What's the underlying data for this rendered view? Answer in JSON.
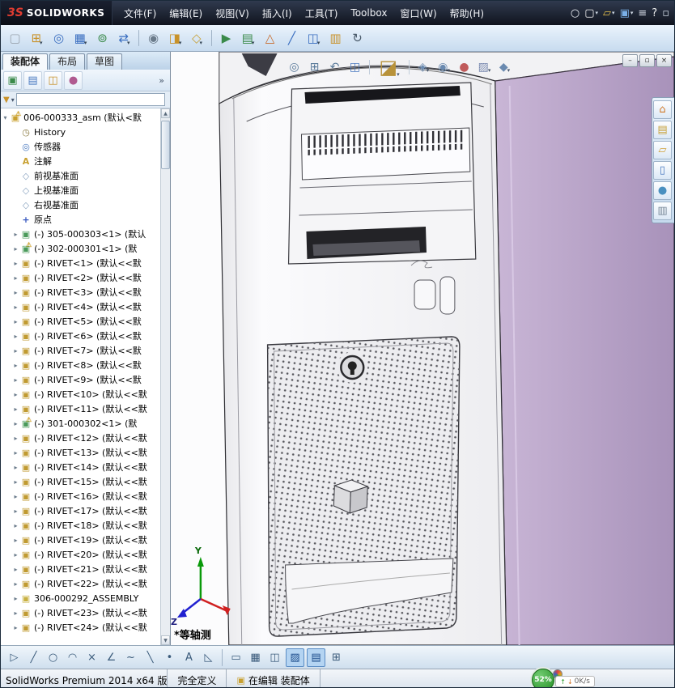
{
  "titlebar": {
    "logo_prefix": "3S",
    "logo_text": "SOLIDWORKS",
    "menus": [
      {
        "n": "menu-file",
        "label": "文件(F)"
      },
      {
        "n": "menu-edit",
        "label": "编辑(E)"
      },
      {
        "n": "menu-view",
        "label": "视图(V)"
      },
      {
        "n": "menu-insert",
        "label": "插入(I)"
      },
      {
        "n": "menu-tools",
        "label": "工具(T)"
      },
      {
        "n": "menu-toolbox",
        "label": "Toolbox"
      },
      {
        "n": "menu-window",
        "label": "窗口(W)"
      },
      {
        "n": "menu-help",
        "label": "帮助(H)"
      }
    ],
    "quick": [
      {
        "n": "search-icon",
        "g": "○",
        "st": "color:#e8ecf2"
      },
      {
        "n": "new-document-icon",
        "g": "▢",
        "dd": "▾",
        "st": "color:#f0f0f0"
      },
      {
        "n": "open-icon",
        "g": "▱",
        "dd": "▾",
        "st": "color:#e8c24a"
      },
      {
        "n": "save-icon",
        "g": "▣",
        "dd": "▾",
        "st": "color:#7ab0e8"
      },
      {
        "n": "options-icon",
        "g": "≡",
        "st": "color:#d8dee8"
      },
      {
        "n": "help-icon",
        "g": "?",
        "st": "color:#f0f0f0"
      },
      {
        "n": "collapse-toolbar-icon",
        "g": "▫",
        "st": "color:#cfd8e4"
      }
    ]
  },
  "toolbar": {
    "items": [
      {
        "n": "edit-component-icon",
        "g": "▢",
        "st": "color:#9aa4ae"
      },
      {
        "n": "insert-components-icon",
        "g": "⊞",
        "st": "color:#c8922a",
        "dd": "▾"
      },
      {
        "n": "mate-icon",
        "g": "◎",
        "st": "color:#3a6ec0"
      },
      {
        "n": "linear-component-pattern-icon",
        "g": "▦",
        "st": "color:#3a6ec0",
        "dd": "▾"
      },
      {
        "n": "smart-fasteners-icon",
        "g": "⊚",
        "st": "color:#3a8a4a"
      },
      {
        "n": "move-component-icon",
        "g": "⇄",
        "st": "color:#3a6ec0",
        "dd": "▾"
      },
      {
        "t": "sep"
      },
      {
        "n": "show-hidden-components-icon",
        "g": "◉",
        "st": "color:#6a7a8a"
      },
      {
        "n": "assembly-features-icon",
        "g": "◨",
        "st": "color:#c8922a",
        "dd": "▾"
      },
      {
        "n": "reference-geometry-icon",
        "g": "◇",
        "st": "color:#c8a23a",
        "dd": "▾"
      },
      {
        "t": "sep"
      },
      {
        "n": "new-motion-study-icon",
        "g": "▶",
        "st": "color:#3a8a4a"
      },
      {
        "n": "bill-of-materials-icon",
        "g": "▤",
        "st": "color:#3a8a4a",
        "dd": "▾"
      },
      {
        "n": "exploded-view-icon",
        "g": "△",
        "st": "color:#c86a2a"
      },
      {
        "n": "explode-line-sketch-icon",
        "g": "╱",
        "st": "color:#3a6ec0"
      },
      {
        "n": "interference-detection-icon",
        "g": "◫",
        "st": "color:#3a6ec0",
        "dd": "▾"
      },
      {
        "n": "assembly-visualization-icon",
        "g": "▥",
        "st": "color:#c8922a"
      },
      {
        "n": "update-icon",
        "g": "↻",
        "st": "color:#4a5a6a"
      }
    ]
  },
  "left_panel": {
    "tabs": [
      {
        "n": "tab-assembly",
        "label": "装配体",
        "active": true
      },
      {
        "n": "tab-layout",
        "label": "布局"
      },
      {
        "n": "tab-sketch",
        "label": "草图"
      }
    ],
    "fm_icons": [
      {
        "n": "featuremanager-tree-icon",
        "g": "▣",
        "st": "color:#3a8a4a"
      },
      {
        "n": "propertymanager-icon",
        "g": "▤",
        "st": "color:#4a7ac0"
      },
      {
        "n": "configurationmanager-icon",
        "g": "◫",
        "st": "color:#c8922a"
      },
      {
        "n": "displaymanager-icon",
        "g": "●",
        "st": "color:#b05a90"
      }
    ],
    "chevron": "»",
    "filter": {
      "funnel": "▼",
      "dd": "▾"
    },
    "scroll": {
      "up": "▲",
      "down": "▼"
    },
    "tree": {
      "items": [
        {
          "ind": 0,
          "tw": "▾",
          "kind": "root",
          "n": "assembly-root-icon",
          "g": "▣",
          "warn": "⚠",
          "label": "006-000333_asm (默认<默"
        },
        {
          "ind": 1,
          "tw": "",
          "kind": "history",
          "n": "history-icon",
          "g": "◷",
          "label": "History"
        },
        {
          "ind": 1,
          "tw": "",
          "kind": "sensors",
          "n": "sensors-icon",
          "g": "◎",
          "label": "传感器"
        },
        {
          "ind": 1,
          "tw": "",
          "kind": "note",
          "n": "annotations-icon",
          "g": "A",
          "label": "注解"
        },
        {
          "ind": 1,
          "tw": "",
          "kind": "plane",
          "n": "plane-icon",
          "g": "◇",
          "label": "前视基准面"
        },
        {
          "ind": 1,
          "tw": "",
          "kind": "plane",
          "n": "plane-icon",
          "g": "◇",
          "label": "上视基准面"
        },
        {
          "ind": 1,
          "tw": "",
          "kind": "plane",
          "n": "plane-icon",
          "g": "◇",
          "label": "右视基准面"
        },
        {
          "ind": 1,
          "tw": "",
          "kind": "origin",
          "n": "origin-icon",
          "g": "+",
          "label": "原点"
        },
        {
          "ind": 1,
          "tw": "▸",
          "kind": "comp",
          "n": "component-icon",
          "g": "▣",
          "label": "(-) 305-000303<1> (默认"
        },
        {
          "ind": 1,
          "tw": "▸",
          "kind": "comp",
          "n": "component-icon",
          "g": "▣",
          "warn": "⚠",
          "label": "(-) 302-000301<1> (默"
        },
        {
          "ind": 1,
          "tw": "▸",
          "kind": "rivet",
          "n": "rivet-component-icon",
          "g": "▣",
          "label": "(-) RIVET<1> (默认<<默"
        },
        {
          "ind": 1,
          "tw": "▸",
          "kind": "rivet",
          "n": "rivet-component-icon",
          "g": "▣",
          "label": "(-) RIVET<2> (默认<<默"
        },
        {
          "ind": 1,
          "tw": "▸",
          "kind": "rivet",
          "n": "rivet-component-icon",
          "g": "▣",
          "label": "(-) RIVET<3> (默认<<默"
        },
        {
          "ind": 1,
          "tw": "▸",
          "kind": "rivet",
          "n": "rivet-component-icon",
          "g": "▣",
          "label": "(-) RIVET<4> (默认<<默"
        },
        {
          "ind": 1,
          "tw": "▸",
          "kind": "rivet",
          "n": "rivet-component-icon",
          "g": "▣",
          "label": "(-) RIVET<5> (默认<<默"
        },
        {
          "ind": 1,
          "tw": "▸",
          "kind": "rivet",
          "n": "rivet-component-icon",
          "g": "▣",
          "label": "(-) RIVET<6> (默认<<默"
        },
        {
          "ind": 1,
          "tw": "▸",
          "kind": "rivet",
          "n": "rivet-component-icon",
          "g": "▣",
          "label": "(-) RIVET<7> (默认<<默"
        },
        {
          "ind": 1,
          "tw": "▸",
          "kind": "rivet",
          "n": "rivet-component-icon",
          "g": "▣",
          "label": "(-) RIVET<8> (默认<<默"
        },
        {
          "ind": 1,
          "tw": "▸",
          "kind": "rivet",
          "n": "rivet-component-icon",
          "g": "▣",
          "label": "(-) RIVET<9> (默认<<默"
        },
        {
          "ind": 1,
          "tw": "▸",
          "kind": "rivet",
          "n": "rivet-component-icon",
          "g": "▣",
          "label": "(-) RIVET<10> (默认<<默"
        },
        {
          "ind": 1,
          "tw": "▸",
          "kind": "rivet",
          "n": "rivet-component-icon",
          "g": "▣",
          "label": "(-) RIVET<11> (默认<<默"
        },
        {
          "ind": 1,
          "tw": "▸",
          "kind": "comp",
          "n": "component-icon",
          "g": "▣",
          "warn": "⚠",
          "label": "(-) 301-000302<1> (默"
        },
        {
          "ind": 1,
          "tw": "▸",
          "kind": "rivet",
          "n": "rivet-component-icon",
          "g": "▣",
          "label": "(-) RIVET<12> (默认<<默"
        },
        {
          "ind": 1,
          "tw": "▸",
          "kind": "rivet",
          "n": "rivet-component-icon",
          "g": "▣",
          "label": "(-) RIVET<13> (默认<<默"
        },
        {
          "ind": 1,
          "tw": "▸",
          "kind": "rivet",
          "n": "rivet-component-icon",
          "g": "▣",
          "label": "(-) RIVET<14> (默认<<默"
        },
        {
          "ind": 1,
          "tw": "▸",
          "kind": "rivet",
          "n": "rivet-component-icon",
          "g": "▣",
          "label": "(-) RIVET<15> (默认<<默"
        },
        {
          "ind": 1,
          "tw": "▸",
          "kind": "rivet",
          "n": "rivet-component-icon",
          "g": "▣",
          "label": "(-) RIVET<16> (默认<<默"
        },
        {
          "ind": 1,
          "tw": "▸",
          "kind": "rivet",
          "n": "rivet-component-icon",
          "g": "▣",
          "label": "(-) RIVET<17> (默认<<默"
        },
        {
          "ind": 1,
          "tw": "▸",
          "kind": "rivet",
          "n": "rivet-component-icon",
          "g": "▣",
          "label": "(-) RIVET<18> (默认<<默"
        },
        {
          "ind": 1,
          "tw": "▸",
          "kind": "rivet",
          "n": "rivet-component-icon",
          "g": "▣",
          "label": "(-) RIVET<19> (默认<<默"
        },
        {
          "ind": 1,
          "tw": "▸",
          "kind": "rivet",
          "n": "rivet-component-icon",
          "g": "▣",
          "label": "(-) RIVET<20> (默认<<默"
        },
        {
          "ind": 1,
          "tw": "▸",
          "kind": "rivet",
          "n": "rivet-component-icon",
          "g": "▣",
          "label": "(-) RIVET<21> (默认<<默"
        },
        {
          "ind": 1,
          "tw": "▸",
          "kind": "rivet",
          "n": "rivet-component-icon",
          "g": "▣",
          "label": "(-) RIVET<22> (默认<<默"
        },
        {
          "ind": 1,
          "tw": "▸",
          "kind": "subasm",
          "n": "subassembly-icon",
          "g": "▣",
          "label": "306-000292_ASSEMBLY"
        },
        {
          "ind": 1,
          "tw": "▸",
          "kind": "rivet",
          "n": "rivet-component-icon",
          "g": "▣",
          "label": "(-) RIVET<23> (默认<<默"
        },
        {
          "ind": 1,
          "tw": "▸",
          "kind": "rivet",
          "n": "rivet-component-icon",
          "g": "▣",
          "label": "(-) RIVET<24> (默认<<默"
        }
      ]
    }
  },
  "viewport": {
    "headsup": [
      {
        "n": "zoom-fit-icon",
        "g": "◎",
        "st": "color:#5a7a9a"
      },
      {
        "n": "zoom-area-icon",
        "g": "⊞",
        "st": "color:#5a7a9a"
      },
      {
        "n": "previous-view-icon",
        "g": "↶",
        "st": "color:#5a7a9a"
      },
      {
        "n": "section-view-icon",
        "g": "◫",
        "st": "color:#4a7ac0"
      },
      {
        "t": "sep"
      },
      {
        "n": "view-orientation-icon",
        "g": "◪",
        "big": 1,
        "dd": "▾",
        "st": "color:#b8923a"
      },
      {
        "t": "sep"
      },
      {
        "n": "display-style-icon",
        "g": "◈",
        "dd": "▾",
        "st": "color:#6a8ab0"
      },
      {
        "n": "hide-show-items-icon",
        "g": "◉",
        "dd": "▾",
        "st": "color:#6a8ab0"
      },
      {
        "n": "edit-appearance-icon",
        "g": "●",
        "st": "color:#c05a5a"
      },
      {
        "n": "apply-scene-icon",
        "g": "▨",
        "dd": "▾",
        "st": "color:#7a8ab0"
      },
      {
        "n": "view-settings-icon",
        "g": "◆",
        "dd": "▾",
        "st": "color:#6a8ab0"
      }
    ],
    "window_controls": [
      {
        "n": "minimize-doc-button",
        "g": "–"
      },
      {
        "n": "restore-doc-button",
        "g": "▫"
      },
      {
        "n": "close-doc-button",
        "g": "×"
      }
    ],
    "task_pane": [
      {
        "n": "solidworks-resources-icon",
        "g": "⌂",
        "st": "color:#d07a2a"
      },
      {
        "n": "design-library-icon",
        "g": "▤",
        "st": "color:#c8a23a"
      },
      {
        "n": "file-explorer-icon",
        "g": "▱",
        "st": "color:#d0a23a"
      },
      {
        "n": "view-palette-icon",
        "g": "▯",
        "st": "color:#4a7ac0"
      },
      {
        "n": "appearances-scenes-icon",
        "g": "●",
        "st": "color:#4a90c0"
      },
      {
        "n": "custom-properties-icon",
        "g": "▥",
        "st": "color:#7a8a9a"
      }
    ],
    "view_label": "*等轴测",
    "triad": {
      "y": "Y",
      "z": "Z"
    }
  },
  "bottom_toolbar": {
    "items": [
      {
        "n": "select-tool-icon",
        "g": "▷"
      },
      {
        "n": "line-tool-icon",
        "g": "╱"
      },
      {
        "n": "circle-tool-icon",
        "g": "○"
      },
      {
        "n": "arc-tool-icon",
        "g": "◠"
      },
      {
        "n": "trim-tool-icon",
        "g": "×"
      },
      {
        "n": "angle-dimension-icon",
        "g": "∠"
      },
      {
        "n": "spline-tool-icon",
        "g": "~"
      },
      {
        "n": "centerline-tool-icon",
        "g": "╲"
      },
      {
        "n": "point-tool-icon",
        "g": "•"
      },
      {
        "n": "text-tool-icon",
        "g": "A"
      },
      {
        "n": "dimension-tool-icon",
        "g": "◺"
      },
      {
        "t": "sep"
      },
      {
        "n": "rectangle-tool-icon",
        "g": "▭"
      },
      {
        "n": "sketch-pattern-icon",
        "g": "▦"
      },
      {
        "n": "mirror-entities-icon",
        "g": "◫"
      },
      {
        "n": "shaded-sketch-icon",
        "g": "▨",
        "pressed": true
      },
      {
        "n": "instant2d-icon",
        "g": "▤",
        "pressed": true
      },
      {
        "n": "grid-snap-icon",
        "g": "⊞"
      }
    ]
  },
  "status_bar": {
    "left_text": "SolidWorks Premium 2014 x64 版",
    "define_state": "完全定义",
    "edit_state": "在编辑 装配体",
    "badge_percent": "52%",
    "net_up": "↑",
    "net_down": "↓",
    "net_speed": "0K/s"
  }
}
